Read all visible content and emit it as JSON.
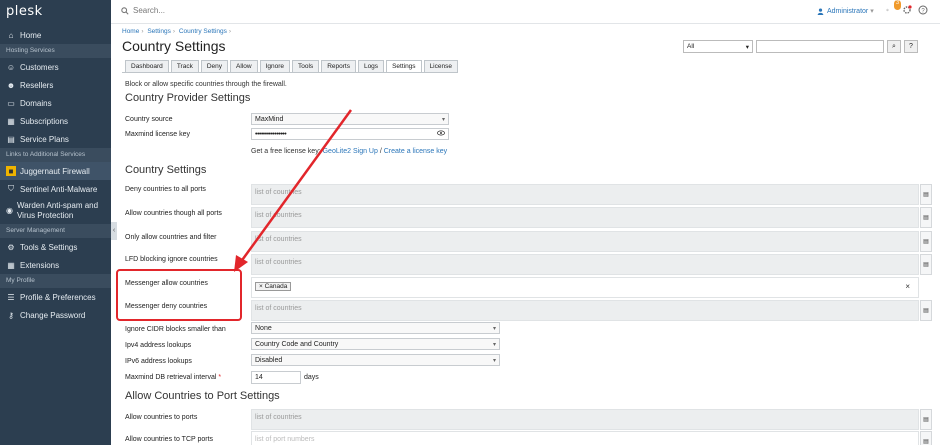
{
  "app": {
    "logo": "plesk"
  },
  "sidebar": {
    "items": [
      {
        "label": "Home",
        "icon": "home-icon"
      },
      {
        "section": "Hosting Services"
      },
      {
        "label": "Customers",
        "icon": "users-icon"
      },
      {
        "label": "Resellers",
        "icon": "reseller-icon"
      },
      {
        "label": "Domains",
        "icon": "monitor-icon"
      },
      {
        "label": "Subscriptions",
        "icon": "subscriptions-icon"
      },
      {
        "label": "Service Plans",
        "icon": "plans-icon"
      },
      {
        "section": "Links to Additional Services"
      },
      {
        "label": "Juggernaut Firewall",
        "icon": "firewall-icon",
        "active": true
      },
      {
        "label": "Sentinel Anti-Malware",
        "icon": "shield-icon"
      },
      {
        "label": "Warden Anti-spam and Virus Protection",
        "icon": "warden-icon"
      },
      {
        "section": "Server Management"
      },
      {
        "label": "Tools & Settings",
        "icon": "tools-icon"
      },
      {
        "label": "Extensions",
        "icon": "extensions-icon"
      },
      {
        "section": "My Profile"
      },
      {
        "label": "Profile & Preferences",
        "icon": "profile-icon"
      },
      {
        "label": "Change Password",
        "icon": "key-icon"
      }
    ]
  },
  "topbar": {
    "search_placeholder": "Search...",
    "user": "Administrator",
    "notifications_count": "3"
  },
  "breadcrumb": [
    "Home",
    "Settings",
    "Country Settings"
  ],
  "page": {
    "title": "Country Settings",
    "filter_select": "All",
    "description": "Block or allow specific countries through the firewall."
  },
  "tabs": [
    "Dashboard",
    "Track",
    "Deny",
    "Allow",
    "Ignore",
    "Tools",
    "Reports",
    "Logs",
    "Settings",
    "License"
  ],
  "active_tab": "Settings",
  "provider": {
    "heading": "Country Provider Settings",
    "source_label": "Country source",
    "source_value": "MaxMind",
    "key_label": "Maxmind license key",
    "key_value": "••••••••••••••••",
    "hint_prefix": "Get a free license key:",
    "hint_link1": "GeoLite2 Sign Up",
    "hint_sep": "/",
    "hint_link2": "Create a license key"
  },
  "country": {
    "heading": "Country Settings",
    "placeholder": "list of countries",
    "rows": [
      {
        "label": "Deny countries to all ports"
      },
      {
        "label": "Allow countries though all ports"
      },
      {
        "label": "Only allow countries and filter"
      },
      {
        "label": "LFD blocking ignore countries"
      },
      {
        "label": "Messenger allow countries",
        "tag": "Canada"
      },
      {
        "label": "Messenger deny countries"
      }
    ],
    "cidr_label": "Ignore CIDR blocks smaller than",
    "cidr_value": "None",
    "ipv4_label": "Ipv4 address lookups",
    "ipv4_value": "Country Code and Country",
    "ipv6_label": "IPv6 address lookups",
    "ipv6_value": "Disabled",
    "interval_label": "Maxmind DB retrieval interval",
    "interval_required": "*",
    "interval_value": "14",
    "interval_unit": "days"
  },
  "port": {
    "heading": "Allow Countries to Port Settings",
    "ports_label": "Allow countries to ports",
    "ports_placeholder": "list of countries",
    "tcp_label": "Allow countries to TCP ports",
    "tcp_placeholder": "list of port numbers"
  },
  "colors": {
    "sidebar": "#2c3e50",
    "accent": "#2b76b9",
    "annotation": "#e2262b"
  }
}
